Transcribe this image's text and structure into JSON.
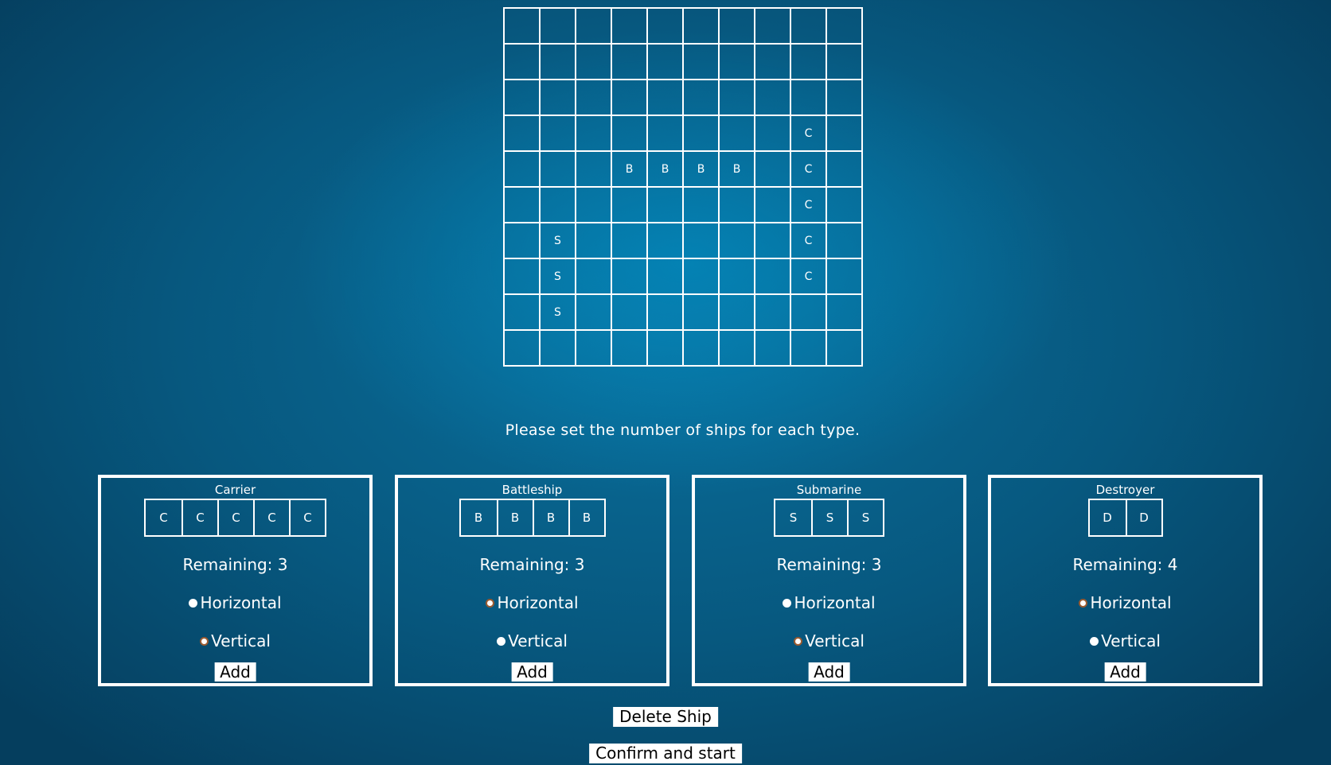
{
  "board": {
    "rows": [
      [
        "",
        "",
        "",
        "",
        "",
        "",
        "",
        "",
        "",
        ""
      ],
      [
        "",
        "",
        "",
        "",
        "",
        "",
        "",
        "",
        "",
        ""
      ],
      [
        "",
        "",
        "",
        "",
        "",
        "",
        "",
        "",
        "",
        ""
      ],
      [
        "",
        "",
        "",
        "",
        "",
        "",
        "",
        "",
        "C",
        ""
      ],
      [
        "",
        "",
        "",
        "B",
        "B",
        "B",
        "B",
        "",
        "C",
        ""
      ],
      [
        "",
        "",
        "",
        "",
        "",
        "",
        "",
        "",
        "C",
        ""
      ],
      [
        "",
        "S",
        "",
        "",
        "",
        "",
        "",
        "",
        "C",
        ""
      ],
      [
        "",
        "S",
        "",
        "",
        "",
        "",
        "",
        "",
        "C",
        ""
      ],
      [
        "",
        "S",
        "",
        "",
        "",
        "",
        "",
        "",
        "",
        ""
      ],
      [
        "",
        "",
        "",
        "",
        "",
        "",
        "",
        "",
        "",
        ""
      ]
    ]
  },
  "prompt": "Please set the number of ships for each type.",
  "panels": [
    {
      "title": "Carrier",
      "cells": [
        "C",
        "C",
        "C",
        "C",
        "C"
      ],
      "remaining": "Remaining: 3",
      "horizontal": "Horizontal",
      "vertical": "Vertical",
      "selected": "horizontal",
      "add": "Add"
    },
    {
      "title": "Battleship",
      "cells": [
        "B",
        "B",
        "B",
        "B"
      ],
      "remaining": "Remaining: 3",
      "horizontal": "Horizontal",
      "vertical": "Vertical",
      "selected": "vertical",
      "add": "Add"
    },
    {
      "title": "Submarine",
      "cells": [
        "S",
        "S",
        "S"
      ],
      "remaining": "Remaining: 3",
      "horizontal": "Horizontal",
      "vertical": "Vertical",
      "selected": "horizontal",
      "add": "Add"
    },
    {
      "title": "Destroyer",
      "cells": [
        "D",
        "D"
      ],
      "remaining": "Remaining: 4",
      "horizontal": "Horizontal",
      "vertical": "Vertical",
      "selected": "vertical",
      "add": "Add"
    }
  ],
  "buttons": {
    "delete": "Delete Ship",
    "confirm": "Confirm and start"
  }
}
